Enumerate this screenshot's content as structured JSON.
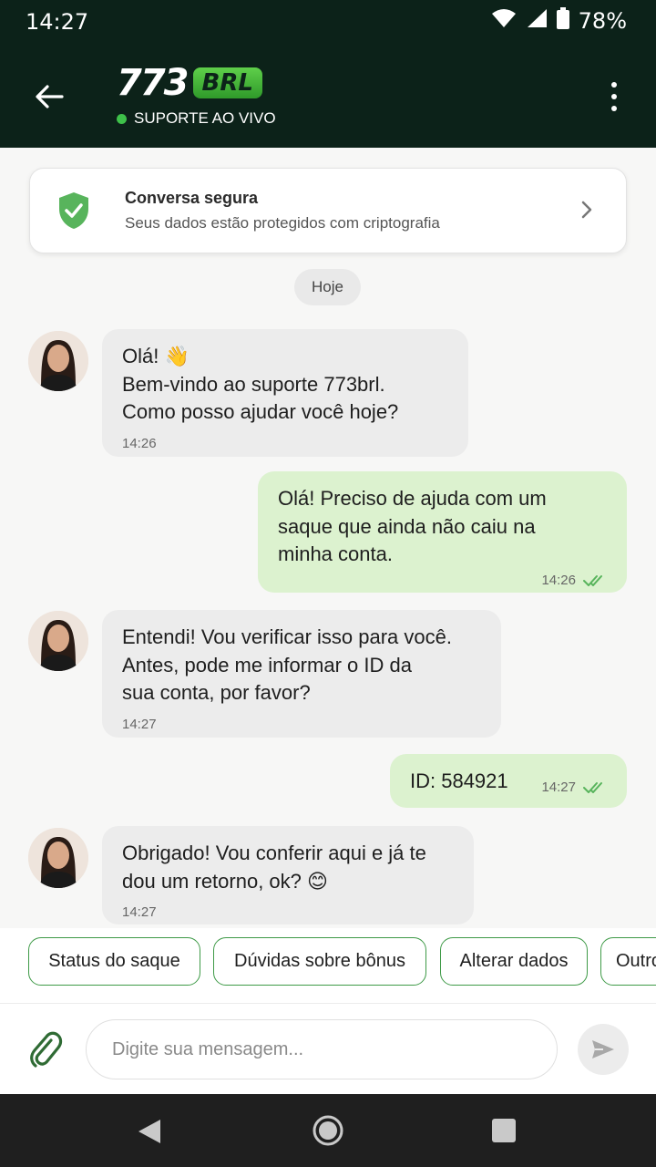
{
  "status_bar": {
    "time": "14:27",
    "battery": "78%"
  },
  "header": {
    "logo_number": "773",
    "logo_brl": "BRL",
    "status": "SUPORTE AO VIVO"
  },
  "secure_card": {
    "title": "Conversa segura",
    "subtitle": "Seus dados estão protegidos com criptografia"
  },
  "date_divider": "Hoje",
  "messages": [
    {
      "direction": "incoming",
      "text": "Olá! 👋\nBem-vindo ao suporte 773brl.\nComo posso ajudar você hoje?",
      "time": "14:26"
    },
    {
      "direction": "outgoing",
      "text": "Olá! Preciso de ajuda com um\nsaque que ainda não caiu na\nminha conta.",
      "time": "14:26"
    },
    {
      "direction": "incoming",
      "text": "Entendi! Vou verificar isso para você.\nAntes, pode me informar o ID da\nsua conta, por favor?",
      "time": "14:27"
    },
    {
      "direction": "outgoing",
      "text": "ID: 584921",
      "time": "14:27"
    },
    {
      "direction": "incoming",
      "text": "Obrigado! Vou conferir aqui e já te\ndou um retorno, ok? 😊",
      "time": "14:27"
    }
  ],
  "quick_replies": [
    "Status do saque",
    "Dúvidas sobre bônus",
    "Alterar dados",
    "Outros"
  ],
  "composer": {
    "placeholder": "Digite sua mensagem..."
  },
  "colors": {
    "header_bg": "#0c2219",
    "brand_green": "#3ec14a",
    "outgoing_bubble": "#dcf2cf",
    "incoming_bubble": "#ececec"
  }
}
